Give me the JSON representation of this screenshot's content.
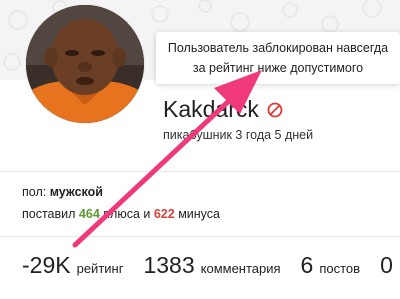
{
  "profile": {
    "username": "Kakdarck",
    "account_age": "пикабушник 3 года 5 дней",
    "ban_icon": "ban-icon"
  },
  "tooltip": {
    "line1": "Пользователь заблокирован навсегда",
    "line2": "за рейтинг ниже допустимого"
  },
  "info": {
    "gender_label": "пол:",
    "gender_value": "мужской",
    "votes_prefix": "поставил",
    "plus_count": "464",
    "plus_label": "плюса и",
    "minus_count": "622",
    "minus_label": "минуса"
  },
  "stats": {
    "rating_value": "-29K",
    "rating_label": "рейтинг",
    "comments_value": "1383",
    "comments_label": "комментария",
    "posts_value": "6",
    "posts_label": "постов",
    "extra_value": "0"
  },
  "colors": {
    "plus": "#5b9b2e",
    "minus": "#d8453b",
    "arrow": "#f0397a",
    "ban": "#e53935"
  }
}
